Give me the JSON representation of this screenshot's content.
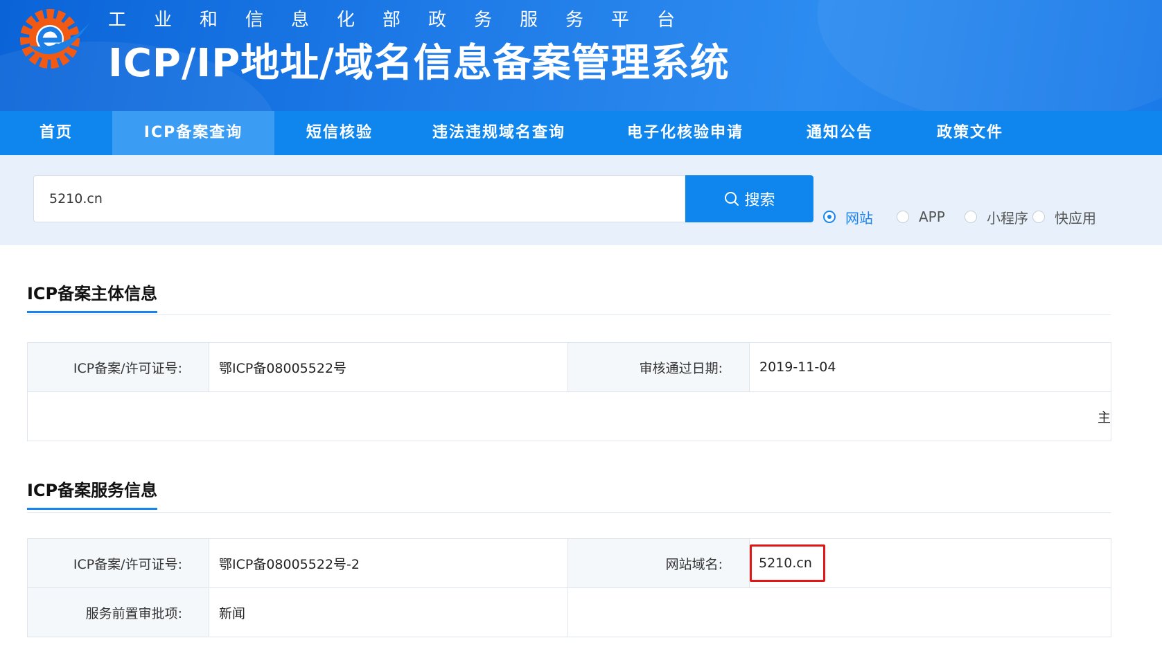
{
  "header": {
    "slogan": "工业和信息化部政务服务平台",
    "title": "ICP/IP地址/域名信息备案管理系统",
    "logo_colors": {
      "gear": "#f25a14",
      "swoosh": "#1c7fe6"
    }
  },
  "nav": {
    "items": [
      {
        "label": "首页"
      },
      {
        "label": "ICP备案查询",
        "active": true
      },
      {
        "label": "短信核验"
      },
      {
        "label": "违法违规域名查询"
      },
      {
        "label": "电子化核验申请"
      },
      {
        "label": "通知公告"
      },
      {
        "label": "政策文件"
      }
    ]
  },
  "search": {
    "value": "5210.cn",
    "button_label": "搜索",
    "types": [
      {
        "label": "网站",
        "checked": true
      },
      {
        "label": "APP",
        "checked": false
      },
      {
        "label": "小程序",
        "checked": false
      },
      {
        "label": "快应用",
        "checked": false
      }
    ]
  },
  "subject_info": {
    "title": "ICP备案主体信息",
    "license_label": "ICP备案/许可证号:",
    "license_value": "鄂ICP备08005522号",
    "date_label": "审核通过日期:",
    "date_value": "2019-11-04",
    "clipped_text": "主"
  },
  "service_info": {
    "title": "ICP备案服务信息",
    "license_label": "ICP备案/许可证号:",
    "license_value": "鄂ICP备08005522号-2",
    "domain_label": "网站域名:",
    "domain_value": "5210.cn",
    "approval_label": "服务前置审批项:",
    "approval_value": "新闻"
  },
  "colors": {
    "primary": "#0f86ee",
    "highlight_box": "#e01717"
  }
}
